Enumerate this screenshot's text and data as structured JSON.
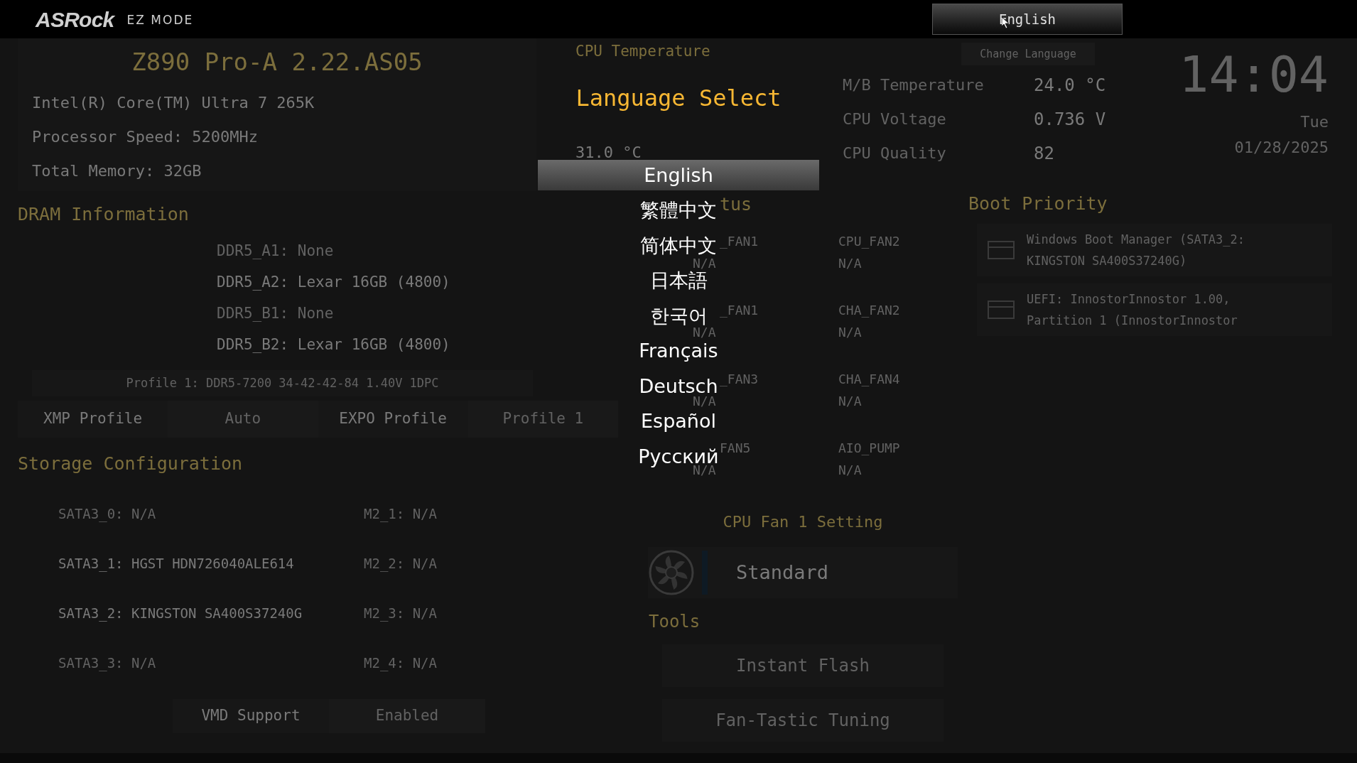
{
  "header": {
    "logo": "ASRock",
    "mode": "EZ MODE",
    "language_button": "English"
  },
  "system": {
    "title": "Z890 Pro-A 2.22.AS05",
    "info": [
      "Intel(R) Core(TM) Ultra 7 265K",
      "Processor Speed: 5200MHz",
      "Total Memory: 32GB"
    ]
  },
  "dram": {
    "heading": "DRAM Information",
    "slots": [
      {
        "text": "DDR5_A1: None",
        "populated": false
      },
      {
        "text": "DDR5_A2: Lexar 16GB (4800)",
        "populated": true
      },
      {
        "text": "DDR5_B1: None",
        "populated": false
      },
      {
        "text": "DDR5_B2: Lexar 16GB (4800)",
        "populated": true
      }
    ],
    "profile": "Profile 1: DDR5-7200 34-42-42-84 1.40V 1DPC",
    "options": [
      {
        "label": "XMP Profile",
        "kind": "label"
      },
      {
        "label": "Auto",
        "kind": "value"
      },
      {
        "label": "EXPO Profile",
        "kind": "label"
      },
      {
        "label": "Profile 1",
        "kind": "value"
      }
    ]
  },
  "storage": {
    "heading": "Storage Configuration",
    "sata": [
      {
        "text": "SATA3_0: N/A",
        "populated": false
      },
      {
        "text": "SATA3_1: HGST HDN726040ALE614",
        "populated": true
      },
      {
        "text": "SATA3_2: KINGSTON SA400S37240G",
        "populated": true
      },
      {
        "text": "SATA3_3: N/A",
        "populated": false
      }
    ],
    "m2": [
      "M2_1: N/A",
      "M2_2: N/A",
      "M2_3: N/A",
      "M2_4: N/A"
    ],
    "vmd": {
      "label": "VMD Support",
      "value": "Enabled"
    }
  },
  "cpu_temperature": {
    "label": "CPU Temperature",
    "value": "31.0 °C"
  },
  "fan_status": {
    "heading": "tus",
    "fans": [
      {
        "name": "_FAN1",
        "reading": "N/A"
      },
      {
        "name": "CPU_FAN2",
        "reading": "N/A"
      },
      {
        "name": "_FAN1",
        "reading": "N/A"
      },
      {
        "name": "CHA_FAN2",
        "reading": "N/A"
      },
      {
        "name": "_FAN3",
        "reading": "N/A"
      },
      {
        "name": "CHA_FAN4",
        "reading": "N/A"
      },
      {
        "name": "FAN5",
        "reading": "N/A"
      },
      {
        "name": "AIO_PUMP",
        "reading": "N/A"
      }
    ]
  },
  "cpu_fan_setting": {
    "title": "CPU Fan 1 Setting",
    "mode": "Standard"
  },
  "tools": {
    "heading": "Tools",
    "buttons": [
      "Instant Flash",
      "Fan-Tastic Tuning"
    ]
  },
  "change_language": "Change Language",
  "monitor": [
    {
      "label": "M/B Temperature",
      "value": "24.0 °C"
    },
    {
      "label": "CPU Voltage",
      "value": "0.736 V"
    },
    {
      "label": "CPU Quality",
      "value": "82"
    }
  ],
  "clock": {
    "time": "14:04",
    "day": "Tue",
    "date": "01/28/2025"
  },
  "boot_priority": {
    "heading": "Boot Priority",
    "items": [
      {
        "lines": [
          "Windows Boot Manager (SATA3_2:",
          "KINGSTON SA400S37240G)"
        ]
      },
      {
        "lines": [
          "UEFI: InnostorInnostor 1.00,",
          "Partition 1 (InnostorInnostor"
        ]
      }
    ]
  },
  "language_dialog": {
    "title": "Language Select",
    "options": [
      {
        "label": "English",
        "selected": true
      },
      {
        "label": "繁體中文",
        "selected": false
      },
      {
        "label": "简体中文",
        "selected": false
      },
      {
        "label": "日本語",
        "selected": false
      },
      {
        "label": "한국어",
        "selected": false
      },
      {
        "label": "Français",
        "selected": false
      },
      {
        "label": "Deutsch",
        "selected": false
      },
      {
        "label": "Español",
        "selected": false
      },
      {
        "label": "Русский",
        "selected": false
      }
    ]
  }
}
